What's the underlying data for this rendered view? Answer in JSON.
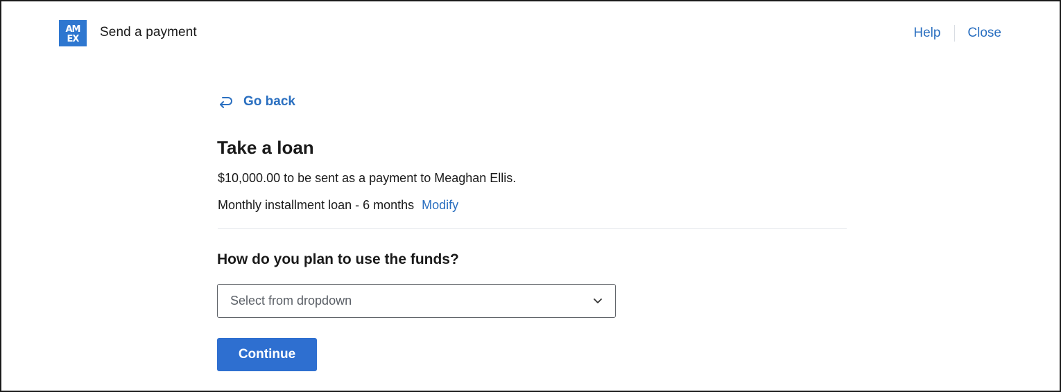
{
  "header": {
    "logo_text": "AMEX",
    "title": "Send a payment",
    "help_label": "Help",
    "close_label": "Close"
  },
  "nav": {
    "go_back_label": "Go back",
    "go_back_icon": "return-arrow-icon"
  },
  "main": {
    "title": "Take a loan",
    "amount_text": "$10,000.00 to be sent as a payment to Meaghan Ellis.",
    "loan_text": "Monthly installment loan - 6 months",
    "modify_label": "Modify",
    "question": "How do you plan to use the funds?",
    "dropdown": {
      "placeholder": "Select from dropdown",
      "icon": "chevron-down-icon"
    },
    "continue_label": "Continue"
  },
  "colors": {
    "brand_blue": "#2e77d0",
    "link_blue": "#2a6fc0",
    "button_blue": "#2e6fd0",
    "text": "#1a1a1a"
  }
}
